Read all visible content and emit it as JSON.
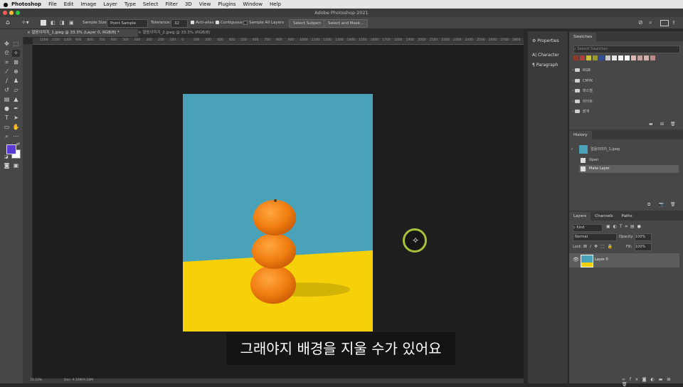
{
  "menubar": {
    "app_name": "Photoshop",
    "items": [
      "File",
      "Edit",
      "Image",
      "Layer",
      "Type",
      "Select",
      "Filter",
      "3D",
      "View",
      "Plugins",
      "Window",
      "Help"
    ]
  },
  "window": {
    "title": "Adobe Photoshop 2021"
  },
  "options_bar": {
    "sample_size_label": "Sample Size:",
    "sample_size_value": "Point Sample",
    "tolerance_label": "Tolerance:",
    "tolerance_value": "32",
    "anti_alias_label": "Anti-alias",
    "contiguous_label": "Contiguous",
    "sample_all_layers_label": "Sample All Layers",
    "select_subject_label": "Select Subject",
    "select_and_mask_label": "Select and Mask..."
  },
  "tabs": [
    {
      "label": "얼음이미지_1.jpeg @ 33.3% (Layer 0, RGB/8) *",
      "close": "×"
    },
    {
      "label": "얼음이미지_2.jpeg @ 33.3% (RGB/8)",
      "close": "×"
    }
  ],
  "ruler_ticks": [
    "1200",
    "1100",
    "1000",
    "900",
    "800",
    "700",
    "600",
    "500",
    "400",
    "300",
    "200",
    "100",
    "0",
    "100",
    "200",
    "300",
    "400",
    "500",
    "600",
    "700",
    "800",
    "900",
    "1000",
    "1100",
    "1200",
    "1300",
    "1400",
    "1500",
    "1600",
    "1700",
    "1800",
    "1900",
    "2000",
    "2100",
    "2200",
    "2300",
    "2400",
    "2500",
    "2600",
    "2700",
    "2800"
  ],
  "status_bar": {
    "zoom": "33.33%",
    "doc_info": "Doc: 9.16M/9.16M"
  },
  "collapsed_panels": [
    "Properties",
    "Character",
    "Paragraph"
  ],
  "swatches": {
    "title": "Swatches",
    "search_placeholder": "Search Swatches",
    "colors": [
      "#8c3a2a",
      "#b23b3b",
      "#c7c13a",
      "#9a9a2a",
      "#2d4f9a",
      "#c9c9c9",
      "#e7e7e7",
      "#f2f2f2",
      "#ffffff",
      "#e0b7b7",
      "#c7a0a0",
      "#d9b0b0",
      "#bb8d8d"
    ],
    "folders": [
      "RGB",
      "CMYK",
      "파스텔",
      "라이트",
      "밝게"
    ]
  },
  "history": {
    "title": "History",
    "snapshot": "얼음이미지_1.jpeg",
    "items": [
      "Open",
      "Make Layer"
    ]
  },
  "layers": {
    "tabs": [
      "Layers",
      "Channels",
      "Paths"
    ],
    "kind_label": "Kind",
    "blend_mode": "Normal",
    "opacity_label": "Opacity:",
    "opacity_value": "100%",
    "lock_label": "Lock:",
    "fill_label": "Fill:",
    "fill_value": "100%",
    "layer_name": "Layer 0"
  },
  "subtitle": "그래야지 배경을 지울 수가 있어요",
  "colors": {
    "foreground": "#5b3bd6",
    "background": "#ffffff",
    "cursor_ring": "#a6c13a"
  }
}
